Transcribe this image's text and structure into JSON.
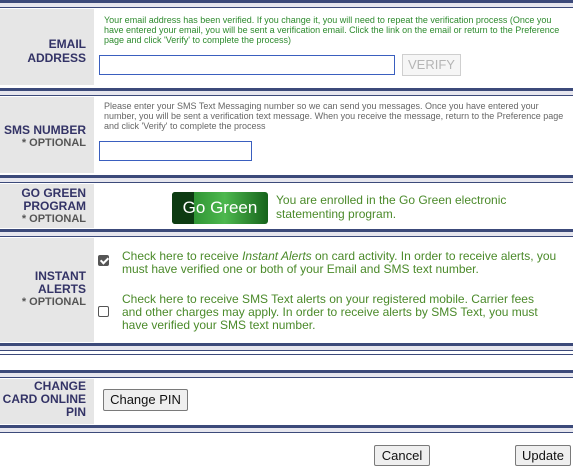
{
  "email": {
    "label_line1": "EMAIL",
    "label_line2": "ADDRESS",
    "note": "Your email address has been verified. If you change it, you will need to repeat the verification process (Once you have entered your email, you will be sent a verification email. Click the link on the email or return to the Preference page and click 'Verify' to complete the process)",
    "value": "",
    "verify_label": "VERIFY"
  },
  "sms": {
    "label": "SMS NUMBER",
    "optional": "* OPTIONAL",
    "note": "Please enter your SMS Text Messaging number so we can send you messages. Once you have entered your number, you will be sent a verification text message. When you receive the message, return to the Preference page and click 'Verify' to complete the process",
    "value": ""
  },
  "gogreen": {
    "label_line1": "GO GREEN",
    "label_line2": "PROGRAM",
    "optional": "* OPTIONAL",
    "logo_text": "Go Green",
    "status": "You are enrolled in the Go Green electronic statementing program."
  },
  "alerts": {
    "label_line1": "INSTANT",
    "label_line2": "ALERTS",
    "optional": "* OPTIONAL",
    "instant_prefix": "Check here to receive ",
    "instant_em": "Instant Alerts",
    "instant_suffix": " on card activity. In order to receive alerts, you must have verified one or both of your Email and SMS text number.",
    "instant_checked": true,
    "sms_text": "Check here to receive SMS Text alerts on your registered mobile. Carrier fees and other charges may apply. In order to receive alerts by SMS Text, you must have verified your SMS text number.",
    "sms_checked": false
  },
  "pin": {
    "label_line1": "CHANGE",
    "label_line2": "CARD ONLINE",
    "label_line3": "PIN",
    "button": "Change PIN"
  },
  "footer": {
    "cancel": "Cancel",
    "update": "Update"
  }
}
